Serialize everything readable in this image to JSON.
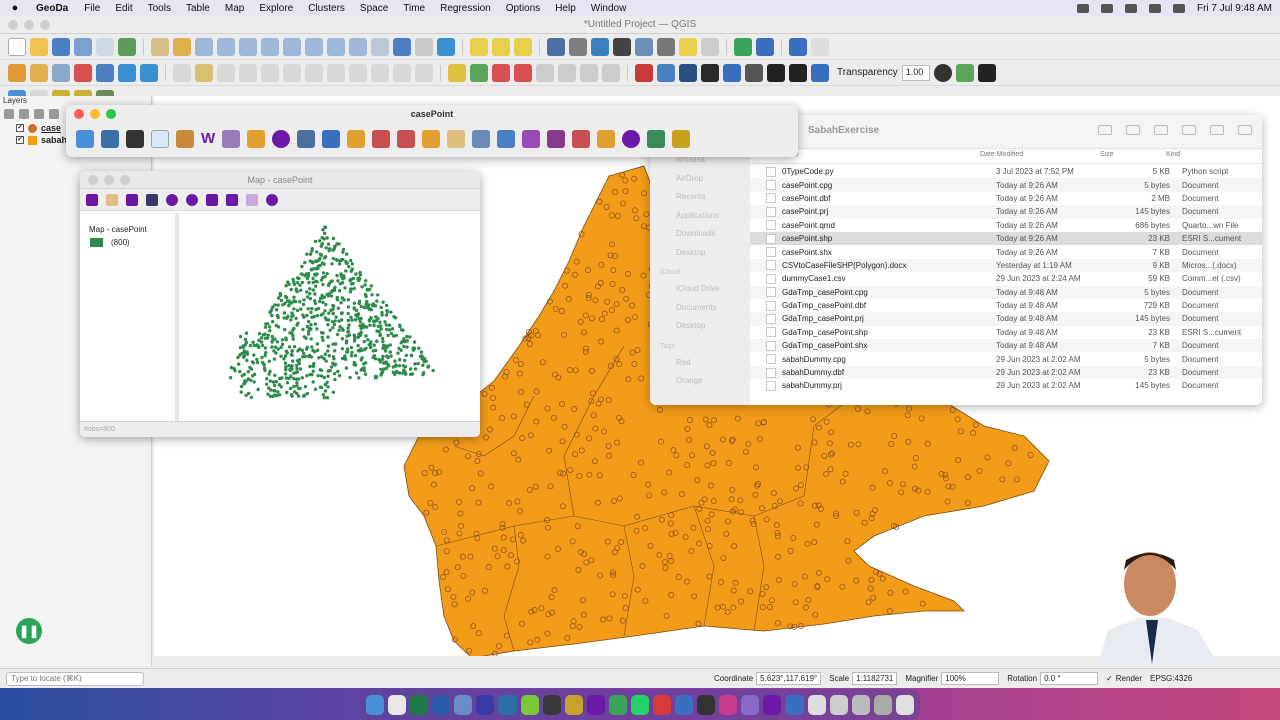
{
  "menubar": {
    "app_name": "GeoDa",
    "items": [
      "File",
      "Edit",
      "Tools",
      "Table",
      "Map",
      "Explore",
      "Clusters",
      "Space",
      "Time",
      "Regression",
      "Options",
      "Help",
      "Window"
    ],
    "clock": "Fri 7 Jul  9:48 AM"
  },
  "qgis": {
    "window_title": "*Untitled Project — QGIS",
    "transparency_label": "Transparency",
    "transparency_value": "1.00",
    "layers_header": "Layers",
    "layers": [
      {
        "name": "case",
        "checked": true,
        "color": "#cf6f2c"
      },
      {
        "name": "sabahDummy",
        "checked": true,
        "color": "#f39c12"
      }
    ],
    "fill_color": "#f39c1a",
    "status": {
      "locate_placeholder": "Type to locate (⌘K)",
      "coordinate_label": "Coordinate",
      "coordinate_value": "5.623°,117.619°",
      "scale_label": "Scale",
      "scale_value": "1:1182731",
      "magnifier_label": "Magnifier",
      "magnifier_value": "100%",
      "rotation_label": "Rotation",
      "rotation_value": "0.0 °",
      "render_label": "Render",
      "crs": "EPSG:4326"
    }
  },
  "geoda_toolbar": {
    "title": "casePoint"
  },
  "geoda_map": {
    "title": "Map - casePoint",
    "legend_title": "Map - casePoint",
    "legend_item": "(800)",
    "point_color": "#2e8b4a",
    "footer": "#obs=800"
  },
  "finder": {
    "title": "SabahExercise",
    "sidebar": [
      "ismailsa",
      "AirDrop",
      "Recents",
      "Applications",
      "Downloads",
      "Desktop"
    ],
    "icloud_header": "iCloud",
    "icloud_items": [
      "iCloud Drive",
      "Documents",
      "Desktop"
    ],
    "tags_header": "Tags",
    "tags": [
      "Red",
      "Orange"
    ],
    "columns": {
      "name": "Name",
      "date": "Date Modified",
      "size": "Size",
      "kind": "Kind"
    },
    "files": [
      {
        "name": "0TypeCode.py",
        "date": "3 Jul 2023 at 7:52 PM",
        "size": "5 KB",
        "kind": "Python script"
      },
      {
        "name": "casePoint.cpg",
        "date": "Today at 9:26 AM",
        "size": "5 bytes",
        "kind": "Document"
      },
      {
        "name": "casePoint.dbf",
        "date": "Today at 9:26 AM",
        "size": "2 MB",
        "kind": "Document"
      },
      {
        "name": "casePoint.prj",
        "date": "Today at 9:26 AM",
        "size": "145 bytes",
        "kind": "Document"
      },
      {
        "name": "casePoint.qmd",
        "date": "Today at 9:26 AM",
        "size": "686 bytes",
        "kind": "Quarto...wn File"
      },
      {
        "name": "casePoint.shp",
        "date": "Today at 9:26 AM",
        "size": "23 KB",
        "kind": "ESRI S...cument"
      },
      {
        "name": "casePoint.shx",
        "date": "Today at 9:26 AM",
        "size": "7 KB",
        "kind": "Document"
      },
      {
        "name": "CSVtoCaseFileSHP(Polygon).docx",
        "date": "Yesterday at 1:19 AM",
        "size": "9 KB",
        "kind": "Micros...(.docx)"
      },
      {
        "name": "dummyCase1.csv",
        "date": "29 Jun 2023 at 2:24 AM",
        "size": "59 KB",
        "kind": "Comm...et (.csv)"
      },
      {
        "name": "GdaTmp_casePoint.cpg",
        "date": "Today at 9:48 AM",
        "size": "5 bytes",
        "kind": "Document"
      },
      {
        "name": "GdaTmp_casePoint.dbf",
        "date": "Today at 9:48 AM",
        "size": "729 KB",
        "kind": "Document"
      },
      {
        "name": "GdaTmp_casePoint.prj",
        "date": "Today at 9:48 AM",
        "size": "145 bytes",
        "kind": "Document"
      },
      {
        "name": "GdaTmp_casePoint.shp",
        "date": "Today at 9:48 AM",
        "size": "23 KB",
        "kind": "ESRI S...cument"
      },
      {
        "name": "GdaTmp_casePoint.shx",
        "date": "Today at 9:48 AM",
        "size": "7 KB",
        "kind": "Document"
      },
      {
        "name": "sabahDummy.cpg",
        "date": "29 Jun 2023 at 2:02 AM",
        "size": "5 bytes",
        "kind": "Document"
      },
      {
        "name": "sabahDummy.dbf",
        "date": "29 Jun 2023 at 2:02 AM",
        "size": "23 KB",
        "kind": "Document"
      },
      {
        "name": "sabahDummy.prj",
        "date": "29 Jun 2023 at 2:02 AM",
        "size": "145 bytes",
        "kind": "Document"
      }
    ],
    "selected_index": 5
  }
}
